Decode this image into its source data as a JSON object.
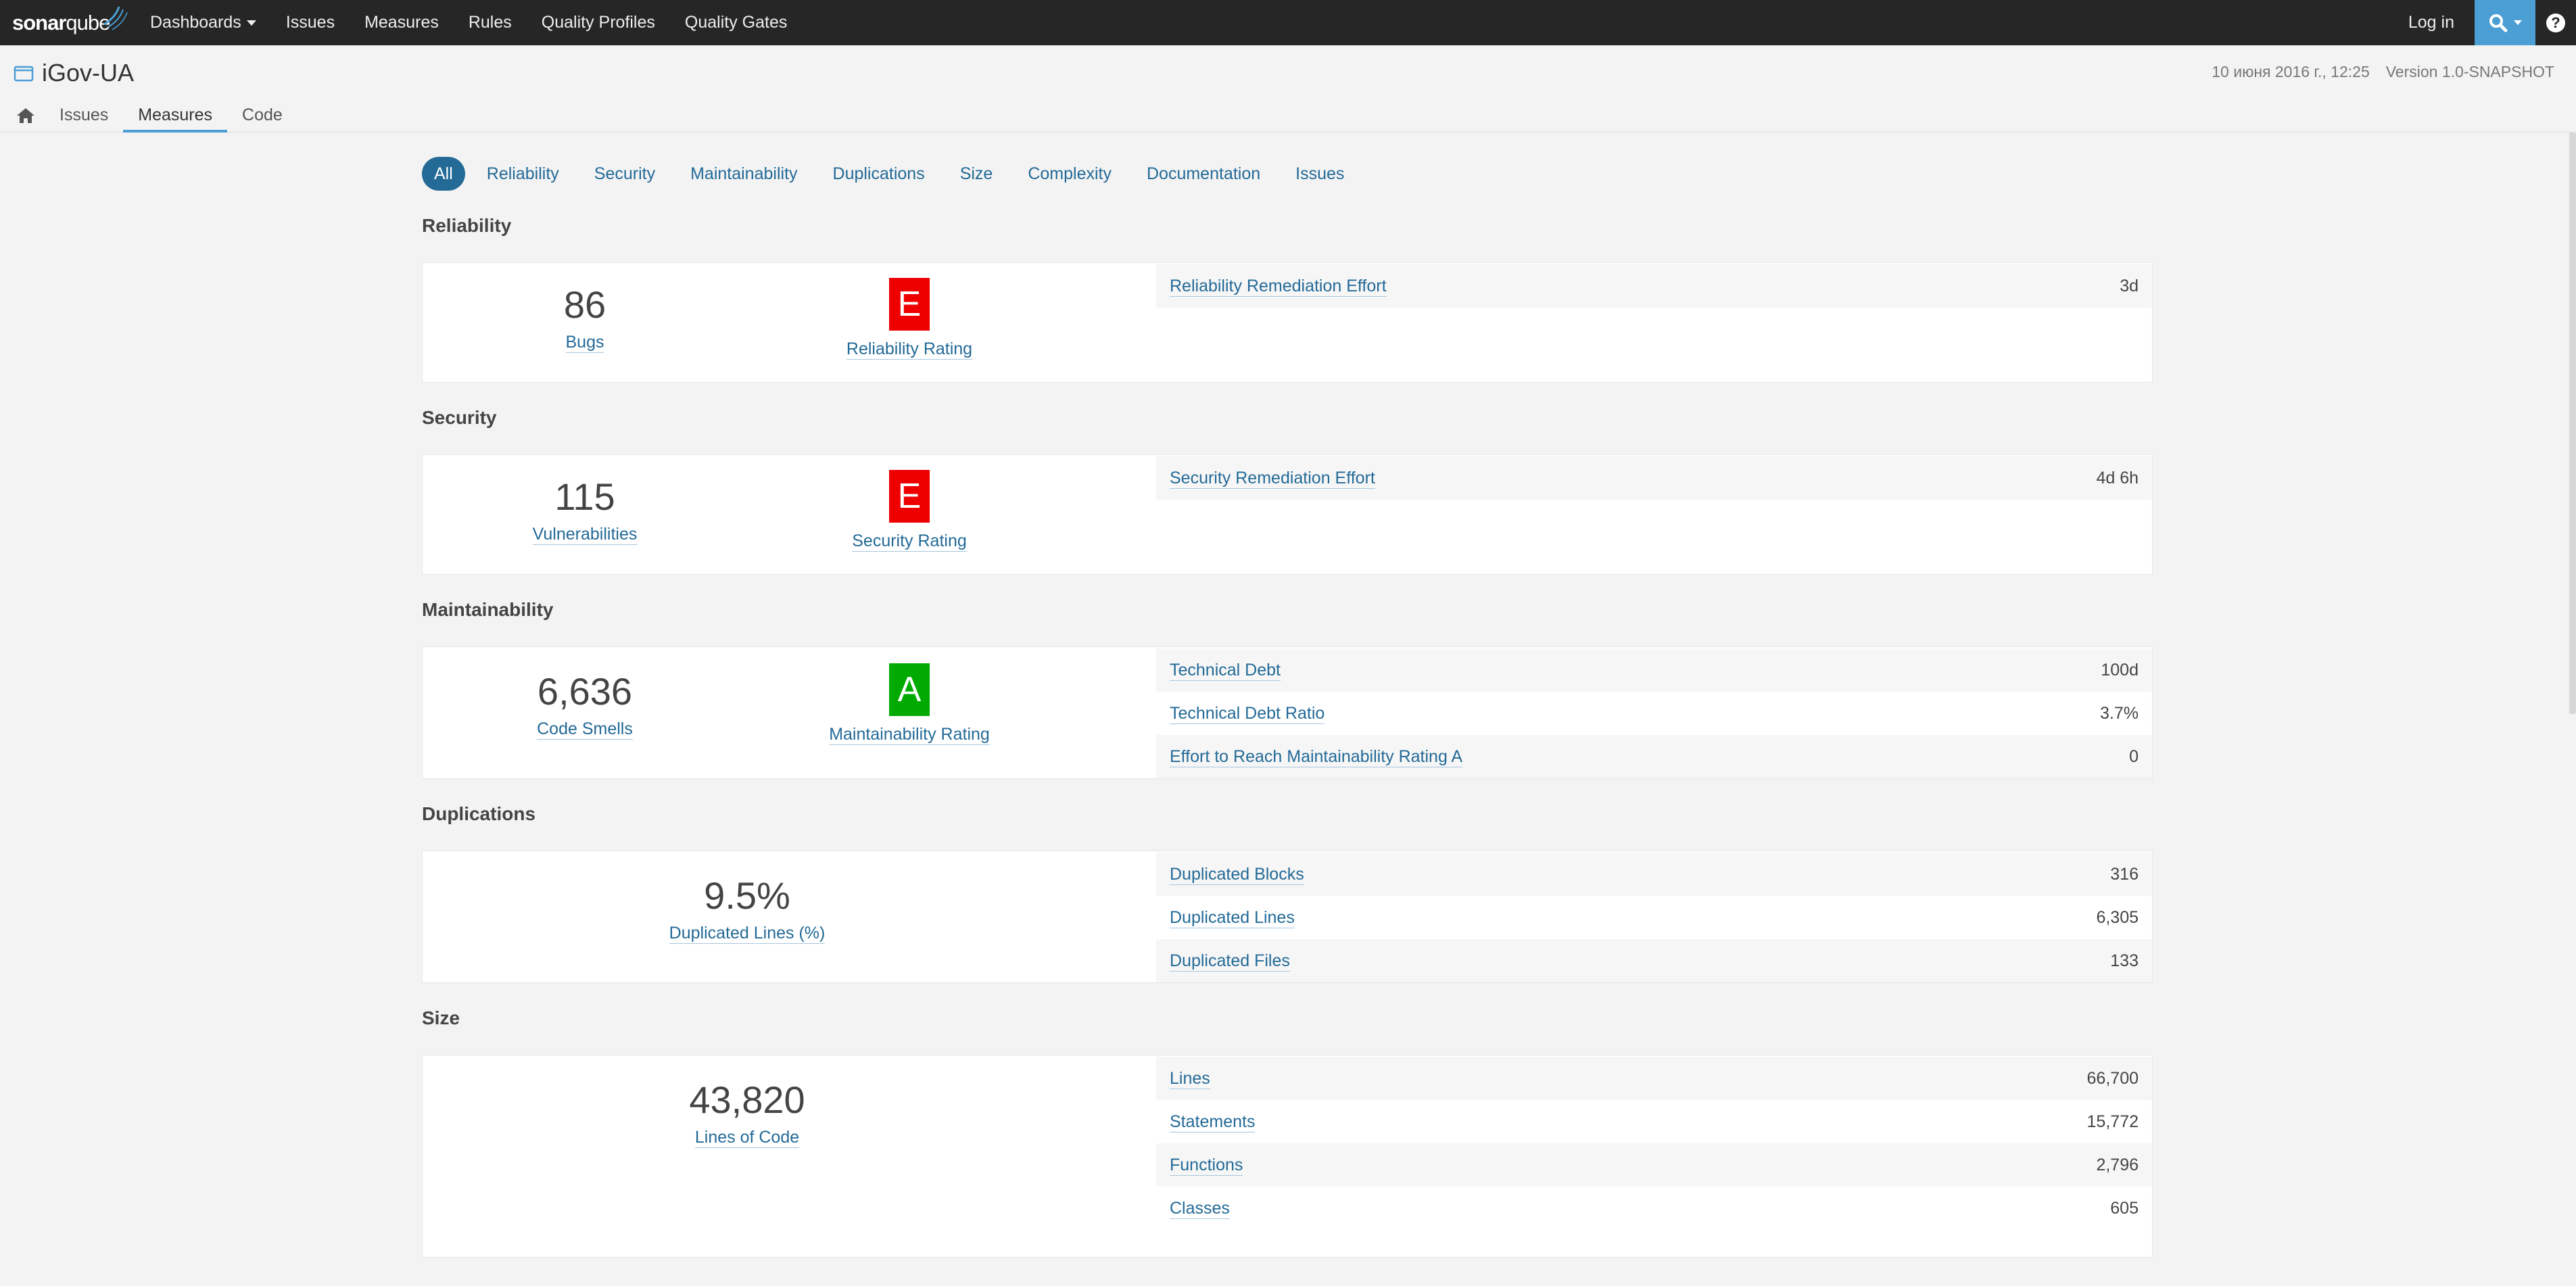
{
  "brand": {
    "bold": "sonar",
    "thin": "qube"
  },
  "nav": {
    "items": [
      {
        "label": "Dashboards"
      },
      {
        "label": "Issues"
      },
      {
        "label": "Measures"
      },
      {
        "label": "Rules"
      },
      {
        "label": "Quality Profiles"
      },
      {
        "label": "Quality Gates"
      }
    ],
    "login": "Log in",
    "help": "?"
  },
  "project": {
    "name": "iGov-UA",
    "date": "10 июня 2016 г., 12:25",
    "version": "Version 1.0-SNAPSHOT",
    "tabs": [
      {
        "label": "Issues"
      },
      {
        "label": "Measures"
      },
      {
        "label": "Code"
      }
    ]
  },
  "filters": [
    {
      "label": "All"
    },
    {
      "label": "Reliability"
    },
    {
      "label": "Security"
    },
    {
      "label": "Maintainability"
    },
    {
      "label": "Duplications"
    },
    {
      "label": "Size"
    },
    {
      "label": "Complexity"
    },
    {
      "label": "Documentation"
    },
    {
      "label": "Issues"
    }
  ],
  "sections": {
    "reliability": {
      "title": "Reliability",
      "count": "86",
      "count_label": "Bugs",
      "rating": "E",
      "rating_label": "Reliability Rating",
      "rows": [
        {
          "name": "Reliability Remediation Effort",
          "value": "3d"
        }
      ]
    },
    "security": {
      "title": "Security",
      "count": "115",
      "count_label": "Vulnerabilities",
      "rating": "E",
      "rating_label": "Security Rating",
      "rows": [
        {
          "name": "Security Remediation Effort",
          "value": "4d 6h"
        }
      ]
    },
    "maintainability": {
      "title": "Maintainability",
      "count": "6,636",
      "count_label": "Code Smells",
      "rating": "A",
      "rating_label": "Maintainability Rating",
      "rows": [
        {
          "name": "Technical Debt",
          "value": "100d"
        },
        {
          "name": "Technical Debt Ratio",
          "value": "3.7%"
        },
        {
          "name": "Effort to Reach Maintainability Rating A",
          "value": "0"
        }
      ]
    },
    "duplications": {
      "title": "Duplications",
      "big": "9.5%",
      "big_label": "Duplicated Lines (%)",
      "rows": [
        {
          "name": "Duplicated Blocks",
          "value": "316"
        },
        {
          "name": "Duplicated Lines",
          "value": "6,305"
        },
        {
          "name": "Duplicated Files",
          "value": "133"
        }
      ]
    },
    "size": {
      "title": "Size",
      "big": "43,820",
      "big_label": "Lines of Code",
      "rows": [
        {
          "name": "Lines",
          "value": "66,700"
        },
        {
          "name": "Statements",
          "value": "15,772"
        },
        {
          "name": "Functions",
          "value": "2,796"
        },
        {
          "name": "Classes",
          "value": "605"
        }
      ]
    }
  },
  "colors": {
    "navbar": "#262626",
    "link": "#236a97",
    "accent": "#4b9fd5",
    "rating_e": "#ee0000",
    "rating_a": "#00aa00"
  }
}
